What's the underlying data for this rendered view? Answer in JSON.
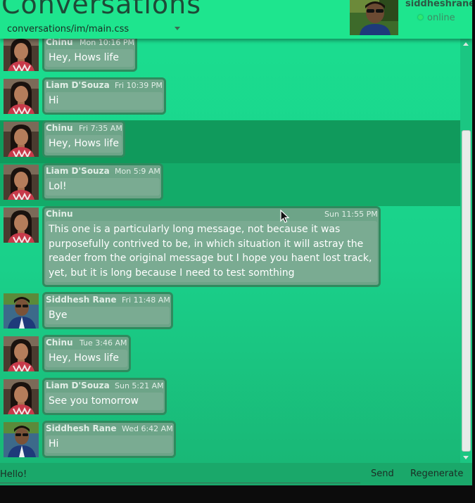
{
  "app": {
    "title": "Conversations"
  },
  "stylesheet": {
    "value": "conversations/im/main.css"
  },
  "user": {
    "name": "siddheshrane",
    "status": "online"
  },
  "messages": [
    {
      "sender": "Chinu",
      "time": "Mon 10:16 PM",
      "text": "Hey, Hows life",
      "avatar": "girl"
    },
    {
      "sender": "Liam D'Souza",
      "time": "Fri 10:39 PM",
      "text": "Hi",
      "avatar": "girl"
    },
    {
      "sender": "Chinu",
      "time": "Fri 7:35 AM",
      "text": "Hey, Hows life",
      "avatar": "girl"
    },
    {
      "sender": "Liam D'Souza",
      "time": "Mon 5:9 AM",
      "text": "Lol!",
      "avatar": "girl"
    },
    {
      "sender": "Chinu",
      "time": "Sun 11:55 PM",
      "text": "This one is a particularly long message, not because it was purposefully contrived to be, in which situation it will astray the reader from the original message but I hope you haent lost track, yet, but it is long because I need to test somthing",
      "avatar": "girl"
    },
    {
      "sender": "Siddhesh Rane",
      "time": "Fri 11:48 AM",
      "text": "Bye",
      "avatar": "boy"
    },
    {
      "sender": "Chinu",
      "time": "Tue 3:46 AM",
      "text": "Hey, Hows life",
      "avatar": "girl"
    },
    {
      "sender": "Liam D'Souza",
      "time": "Sun 5:21 AM",
      "text": "See you tomorrow",
      "avatar": "girl"
    },
    {
      "sender": "Siddhesh Rane",
      "time": "Wed 6:42 AM",
      "text": "Hi",
      "avatar": "boy"
    }
  ],
  "composer": {
    "value": "Hello!",
    "send_label": "Send",
    "regenerate_label": "Regenerate"
  },
  "colors": {
    "header": "#1ee58e",
    "bubble": "#6da488",
    "bubble_border": "#2f8a5e",
    "row_highlight": "#109a5c",
    "status_online": "#2ee870"
  }
}
